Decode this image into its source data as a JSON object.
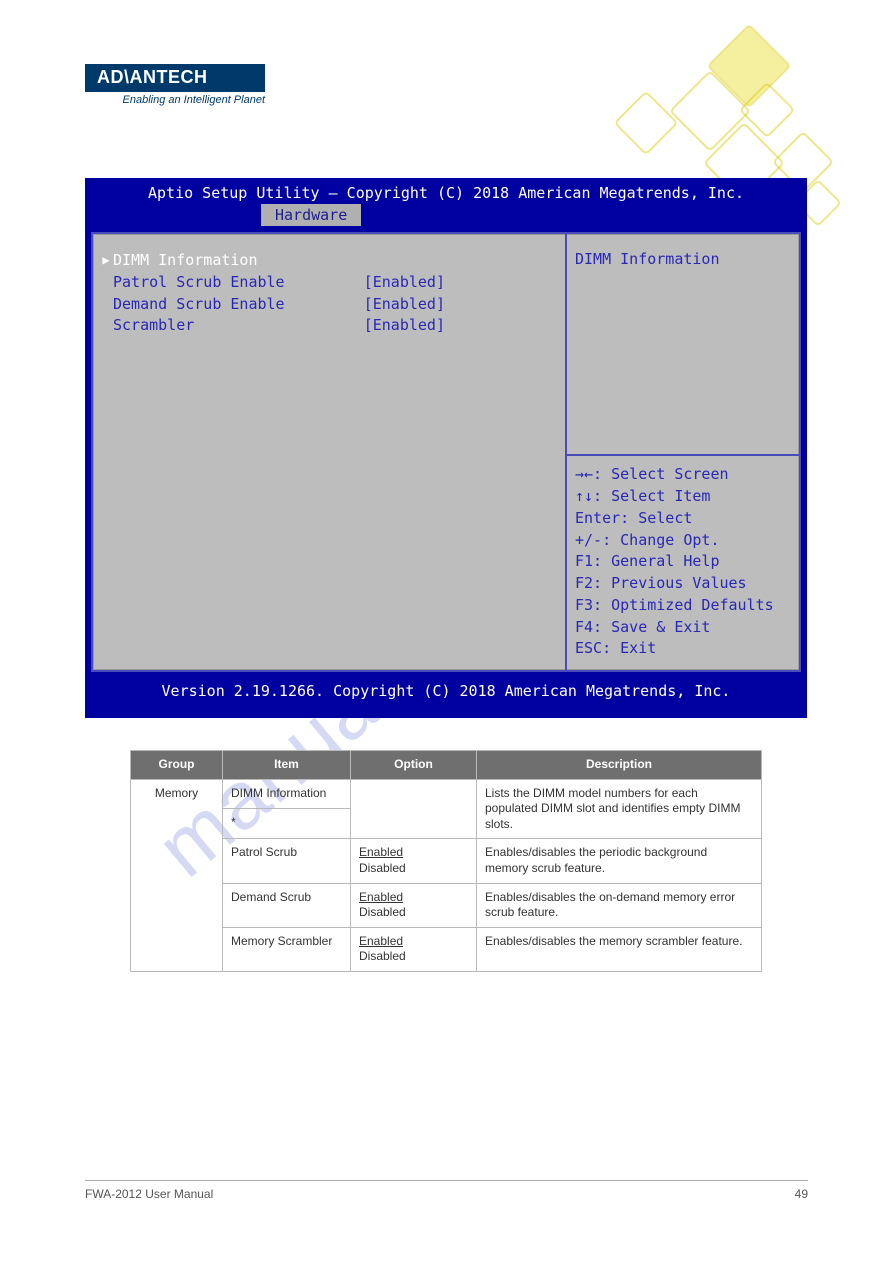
{
  "logo": {
    "brand": "AD\\ANTECH",
    "tagline": "Enabling an Intelligent Planet"
  },
  "watermark": "manualshive.com",
  "bios": {
    "title": "Aptio Setup Utility – Copyright (C) 2018 American Megatrends, Inc.",
    "tab": "Hardware",
    "rows": [
      {
        "label": "DIMM Information",
        "value": "",
        "highlighted": true,
        "caret": true
      },
      {
        "label": "Patrol Scrub Enable",
        "value": "[Enabled]"
      },
      {
        "label": "Demand Scrub Enable",
        "value": "[Enabled]"
      },
      {
        "label": "Scrambler",
        "value": "[Enabled]"
      }
    ],
    "help_title": "DIMM Information",
    "key_help": {
      "screen_sym": "→←:",
      "screen": "Select Screen",
      "item_sym": "↑↓:",
      "item": "Select Item",
      "enter": "Enter: Select",
      "change": "+/-: Change Opt.",
      "f1": "F1: General Help",
      "f2": "F2: Previous Values",
      "f3": "F3: Optimized Defaults",
      "f4": "F4: Save & Exit",
      "esc": "ESC: Exit"
    },
    "footer": "Version 2.19.1266. Copyright (C) 2018 American Megatrends, Inc."
  },
  "table": {
    "headers": {
      "group": "Group",
      "item": "Item",
      "option": "Option",
      "description": "Description"
    },
    "group": "Memory",
    "rows": [
      {
        "item": "DIMM Information",
        "default": "",
        "item_rowspan": true
      },
      {
        "item_suffix": "*",
        "item": "",
        "default": "",
        "desc": "Lists the DIMM model numbers for each populated DIMM slot and identifies empty DIMM slots."
      },
      {
        "item": "Patrol Scrub",
        "default_u": "Enabled",
        "default2": "Disabled",
        "desc": "Enables/disables the periodic background memory scrub feature."
      },
      {
        "item": "Demand Scrub",
        "default_u": "Enabled",
        "default2": "Disabled",
        "desc": "Enables/disables the on-demand memory error scrub feature."
      },
      {
        "item": "Memory Scrambler",
        "default_u": "Enabled",
        "default2": "Disabled",
        "desc": "Enables/disables the memory scrambler feature."
      }
    ]
  },
  "footer": {
    "left": "FWA-2012 User Manual",
    "right": "49"
  }
}
